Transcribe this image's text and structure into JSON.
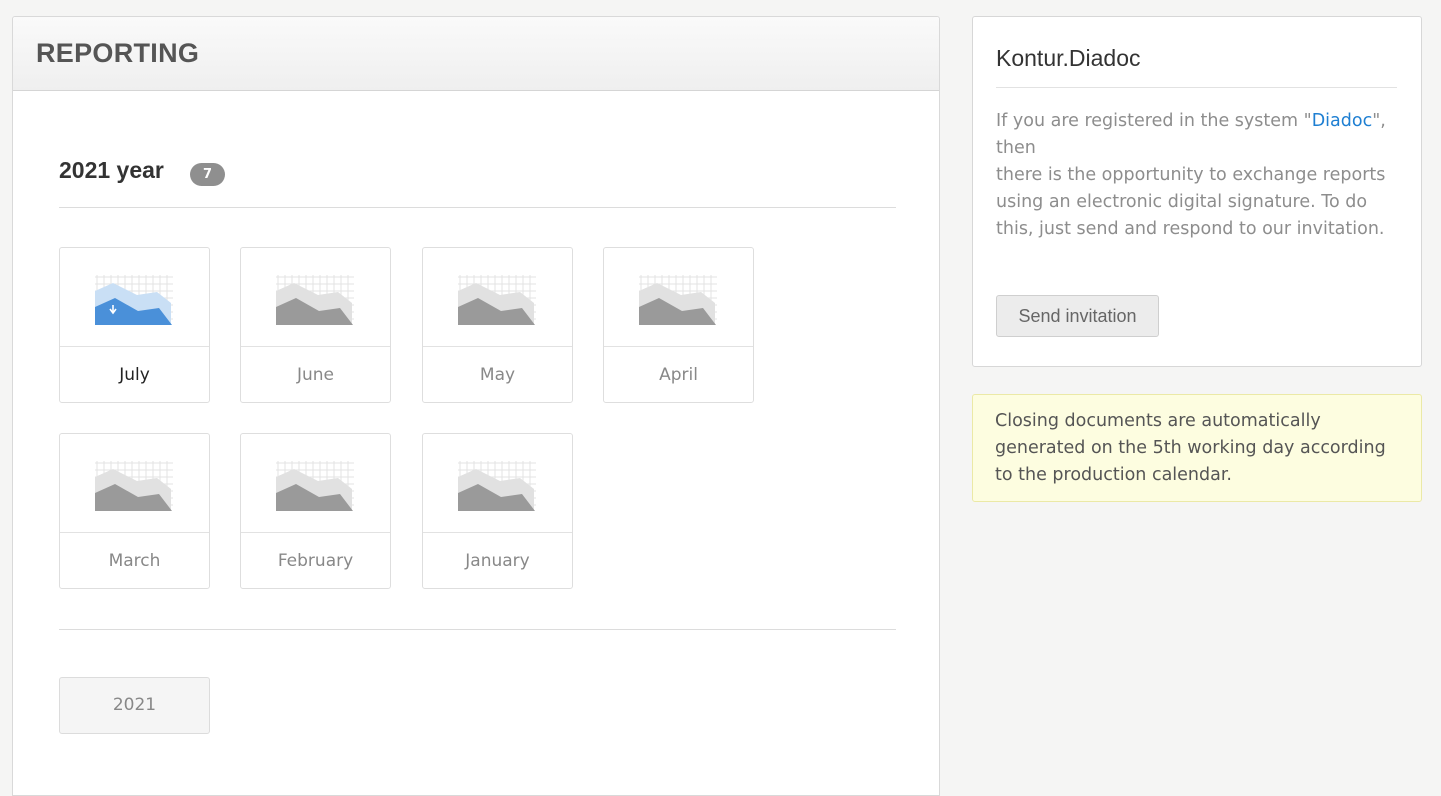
{
  "reporting": {
    "title": "REPORTING",
    "year_heading": "2021 year",
    "report_count": "7",
    "months": [
      {
        "label": "July",
        "active": true
      },
      {
        "label": "June",
        "active": false
      },
      {
        "label": "May",
        "active": false
      },
      {
        "label": "April",
        "active": false
      },
      {
        "label": "March",
        "active": false
      },
      {
        "label": "February",
        "active": false
      },
      {
        "label": "January",
        "active": false
      }
    ],
    "year_buttons": [
      "2021"
    ]
  },
  "diadoc": {
    "title": "Kontur.Diadoc",
    "text_before_link": "If you are registered in the system \"",
    "link_text": "Diadoc",
    "text_after_link": "\", then",
    "text_rest": "there is the opportunity to exchange reports using an electronic digital signature. To do this, just send and respond to our invitation.",
    "button_label": "Send invitation"
  },
  "notice": {
    "text": "Closing documents are automatically generated on the 5th working day according to the production calendar."
  },
  "colors": {
    "active_chart": "#4a90d9",
    "active_chart_back": "#c9dff5",
    "inactive_chart": "#9a9a9a",
    "inactive_chart_back": "#e1e1e1",
    "link": "#1e7fd2",
    "badge": "#8f8f8f",
    "notice_bg": "#fdfde0"
  },
  "icons": {
    "month_chart": "area-chart-icon",
    "download": "download-arrow-icon"
  }
}
